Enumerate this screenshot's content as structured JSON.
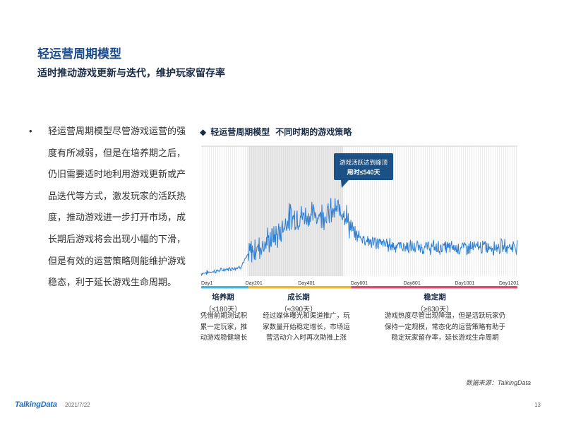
{
  "header": {
    "title": "轻运营周期模型",
    "subtitle": "适时推动游戏更新与迭代，维护玩家留存率"
  },
  "bullet": {
    "symbol": "•",
    "text": "轻运营周期模型尽管游戏运营的强度有所减弱，但是在培养期之后，仍旧需要适时地利用游戏更新或产品迭代等方式，激发玩家的活跃热度，推动游戏进一步打开市场，成长期后游戏将会出现小幅的下滑，但是有效的运营策略则能维护游戏稳态，利于延长游戏生命周期。"
  },
  "chart_title": {
    "diamond": "◆",
    "part1": "轻运营周期模型",
    "part2": "不同时期的游戏策略"
  },
  "callout": {
    "line1": "游戏活跃达到峰顶",
    "line2": "用时≤540天"
  },
  "chart_data": {
    "type": "line",
    "x_ticks": [
      "Day1",
      "Day201",
      "Day401",
      "Day601",
      "Day801",
      "Day1001",
      "Day1201"
    ],
    "xlim": [
      1,
      1201
    ],
    "grid": true,
    "peak_day": 540,
    "phases": [
      {
        "name": "培养期",
        "duration": "（≤180天）",
        "start": 1,
        "end": 180,
        "color": "#3bbcd6"
      },
      {
        "name": "成长期",
        "duration": "（≈390天）",
        "start": 180,
        "end": 570,
        "color": "#f2b927"
      },
      {
        "name": "稳定期",
        "duration": "（≥630天）",
        "start": 570,
        "end": 1201,
        "color": "#de4e6b"
      }
    ],
    "series": [
      {
        "color": "#2e7fd3",
        "envelope": [
          {
            "day": 1,
            "level": 0.02
          },
          {
            "day": 150,
            "level": 0.07
          },
          {
            "day": 185,
            "level": 0.18
          },
          {
            "day": 300,
            "level": 0.33
          },
          {
            "day": 330,
            "level": 0.45
          },
          {
            "day": 480,
            "level": 0.48
          },
          {
            "day": 540,
            "level": 0.52
          },
          {
            "day": 575,
            "level": 0.33
          },
          {
            "day": 650,
            "level": 0.26
          },
          {
            "day": 800,
            "level": 0.22
          },
          {
            "day": 1000,
            "level": 0.22
          },
          {
            "day": 1201,
            "level": 0.23
          }
        ]
      }
    ]
  },
  "phase_descriptions": [
    "凭借前期测试积累一定玩家，推动游戏稳健增长",
    "经过媒体曝光和渠道推广，玩家数量开始稳定增长，市场运营活动介入时再次助推上涨",
    "游戏热度尽管出现降温，但是活跃玩家仍保持一定规模，常态化的运营策略有助于稳定玩家留存率，延长游戏生命周期"
  ],
  "footer": {
    "source": "数据来源：TalkingData",
    "logo": "TalkingData",
    "date": "2021/7/22",
    "page": "13"
  }
}
